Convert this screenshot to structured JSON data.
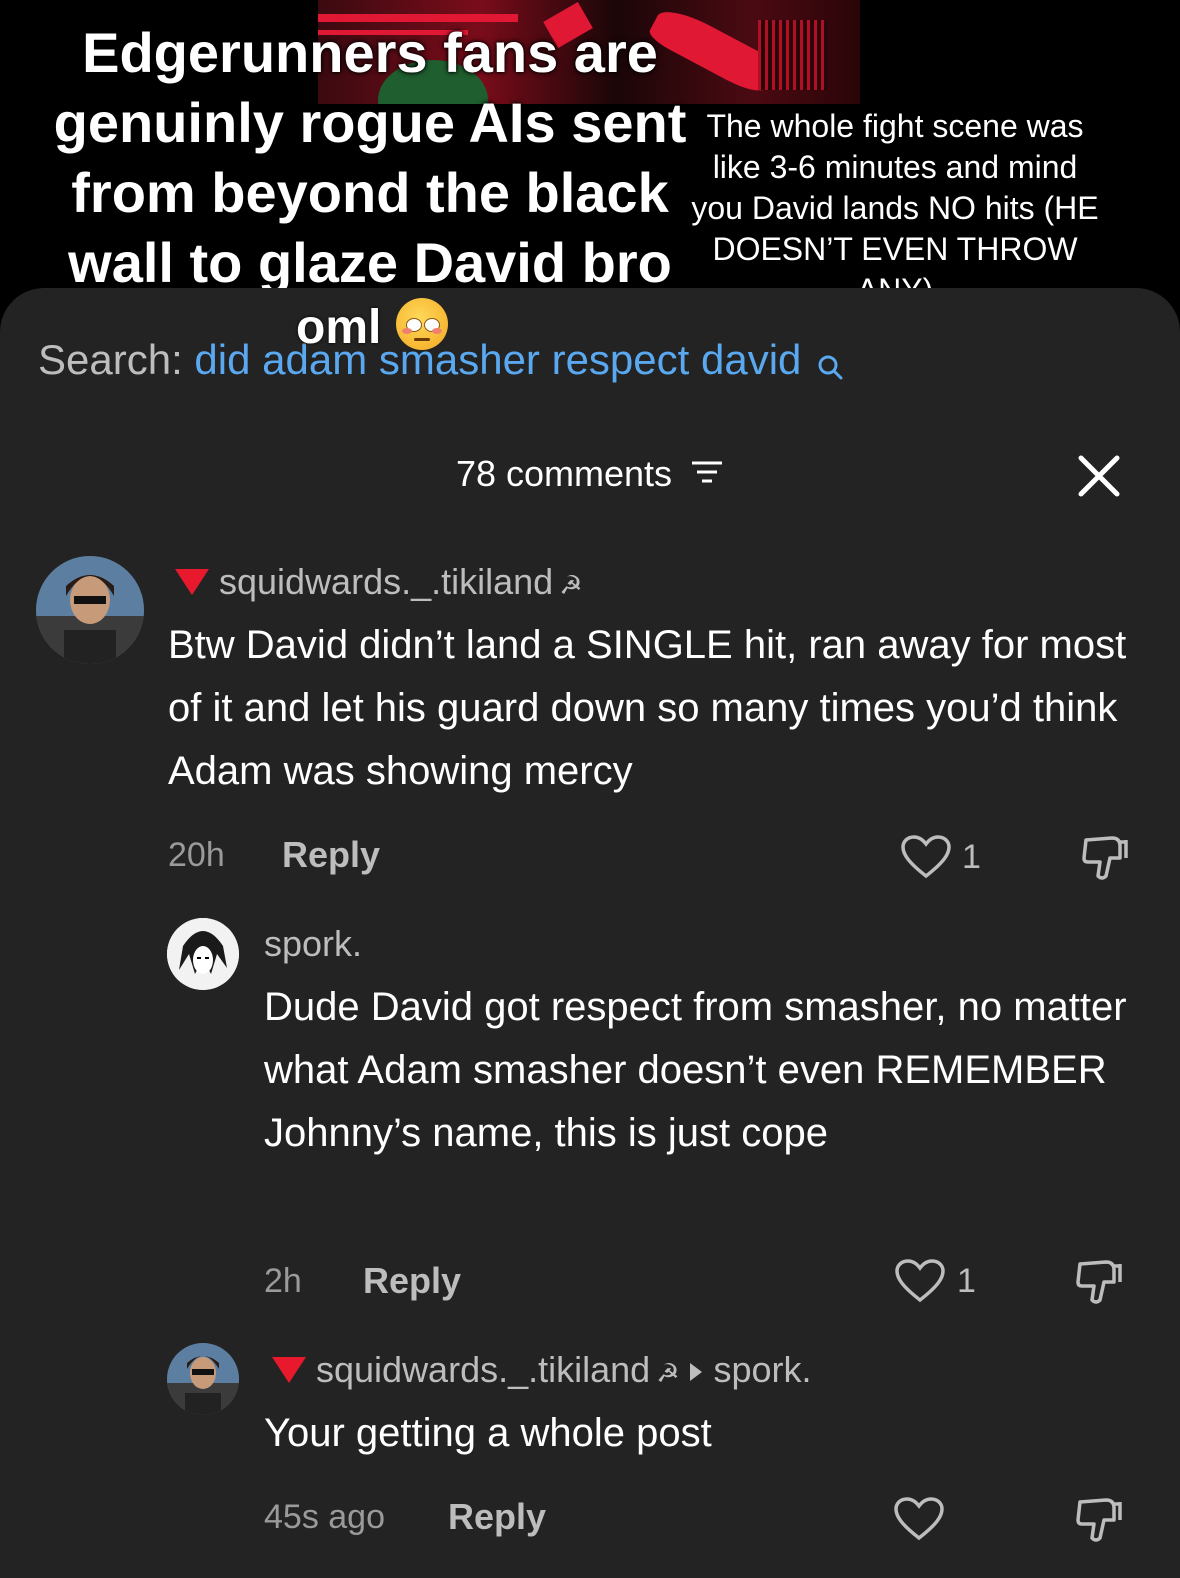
{
  "overlay": {
    "left_caption": "Edgerunners fans are genuinly rogue AIs sent from beyond the black wall to glaze David bro",
    "left_caption_end": "oml",
    "right_caption": "The whole fight scene was like 3-6 minutes and mind you David lands NO hits (HE DOESN’T EVEN THROW ANY)"
  },
  "search": {
    "label": "Search:",
    "query": "did adam smasher respect david"
  },
  "header": {
    "comment_count": "78 comments"
  },
  "comments": [
    {
      "username": "squidwards._.tikiland",
      "text": "Btw David didn’t land a SINGLE hit, ran away for most of it and let his guard down so many times you’d think Adam was showing mercy",
      "time": "20h",
      "reply_label": "Reply",
      "likes": "1"
    },
    {
      "username": "spork.",
      "text": "Dude David got respect from smasher, no matter what Adam smasher doesn’t even REMEMBER Johnny’s name, this is just cope",
      "time": "2h",
      "reply_label": "Reply",
      "likes": "1"
    },
    {
      "username": "squidwards._.tikiland",
      "reply_to": "spork.",
      "text": "Your getting a whole post",
      "time": "45s ago",
      "reply_label": "Reply",
      "likes": ""
    }
  ],
  "icons": {
    "filter": "filter-icon",
    "close": "close-icon",
    "search": "search-icon",
    "like": "heart-icon",
    "dislike": "thumbs-down-icon",
    "badge": "red-triangle-icon",
    "sickle": "hammer-sickle-icon"
  },
  "colors": {
    "sheet_bg": "#232323",
    "search_query": "#5aa9f0",
    "badge_red": "#e8192c"
  }
}
